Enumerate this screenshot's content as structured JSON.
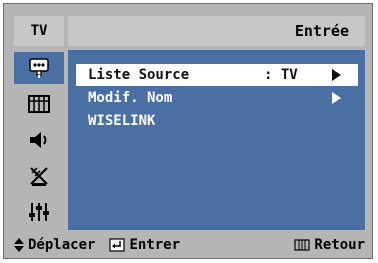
{
  "header": {
    "tab": "TV",
    "title": "Entrée"
  },
  "sidebar": {
    "items": [
      {
        "icon": "input-source-icon",
        "active": true
      },
      {
        "icon": "picture-grid-icon",
        "active": false
      },
      {
        "icon": "speaker-icon",
        "active": false
      },
      {
        "icon": "antenna-icon",
        "active": false
      },
      {
        "icon": "settings-sliders-icon",
        "active": false
      }
    ]
  },
  "menu": {
    "items": [
      {
        "label": "Liste Source",
        "value": ": TV",
        "has_arrow": true,
        "selected": true
      },
      {
        "label": "Modif. Nom",
        "value": "",
        "has_arrow": true,
        "selected": false
      },
      {
        "label": "WISELINK",
        "value": "",
        "has_arrow": false,
        "selected": false
      }
    ]
  },
  "footer": {
    "move_label": "Déplacer",
    "enter_label": "Entrer",
    "return_label": "Retour"
  },
  "colors": {
    "panel_blue": "#4a6fa3",
    "frame_gray": "#b5b5b5",
    "header_gray": "#c7c7c7",
    "highlight": "#ffffff"
  }
}
